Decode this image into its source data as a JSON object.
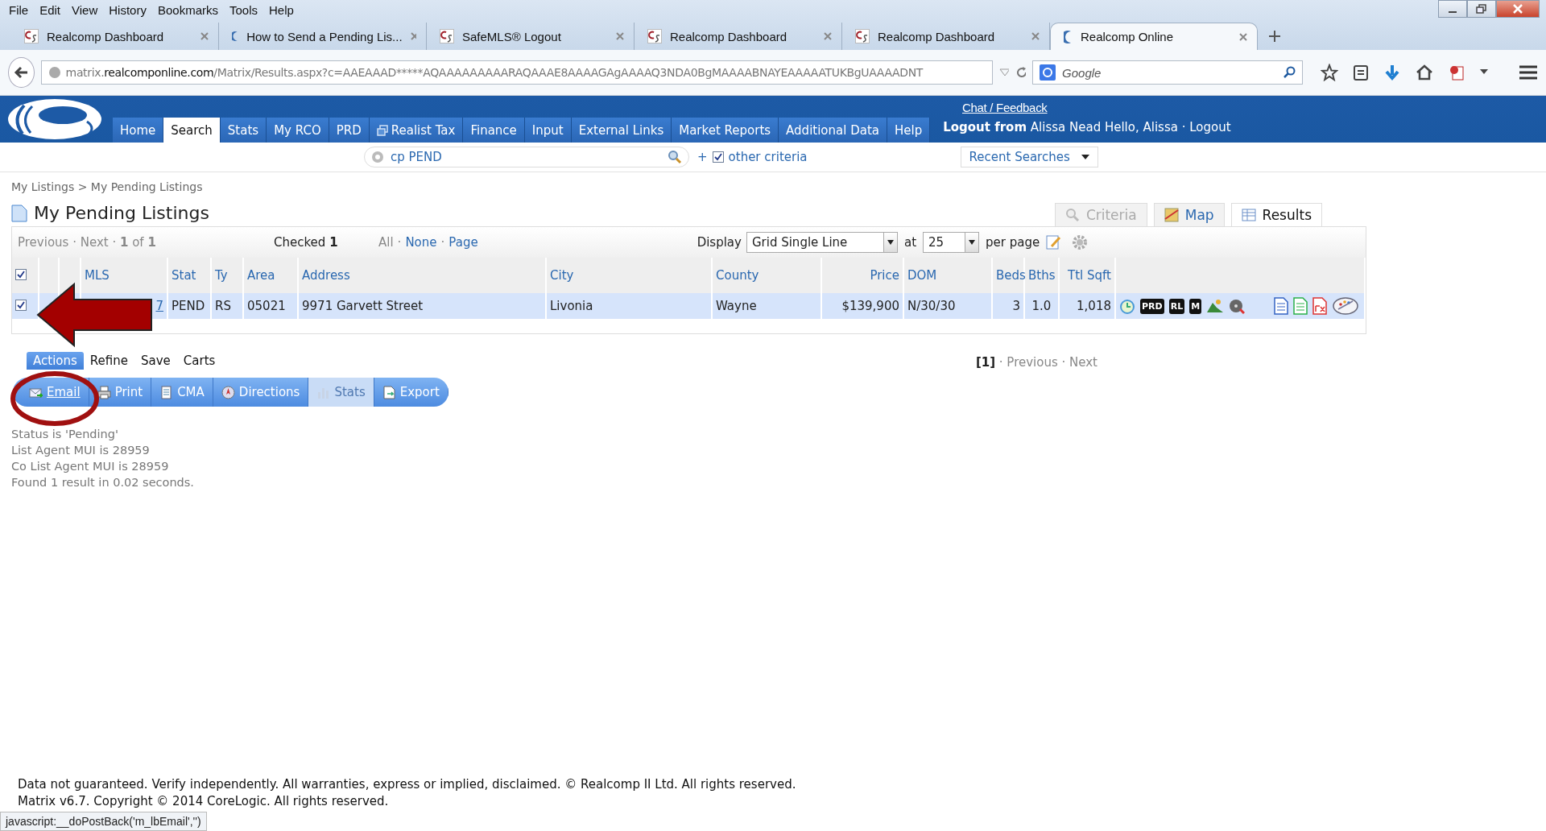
{
  "menu_bar": [
    "File",
    "Edit",
    "View",
    "History",
    "Bookmarks",
    "Tools",
    "Help"
  ],
  "browser_tabs": [
    {
      "title": "Realcomp Dashboard",
      "kind": "cs",
      "selected": false
    },
    {
      "title": "How to Send a Pending Lis...",
      "kind": "moon",
      "selected": false
    },
    {
      "title": "SafeMLS® Logout",
      "kind": "cs",
      "selected": false
    },
    {
      "title": "Realcomp Dashboard",
      "kind": "cs",
      "selected": false
    },
    {
      "title": "Realcomp Dashboard",
      "kind": "cs",
      "selected": false
    },
    {
      "title": "Realcomp Online",
      "kind": "moon",
      "selected": true
    }
  ],
  "address_bar": {
    "prefix": "matrix.",
    "host": "realcomponline.com",
    "rest": "/Matrix/Results.aspx?c=AAEAAAD*****AQAAAAAAAAARAQAAAE8AAAAGAgAAAAQ3NDA0BgMAAAABNAYEAAAAATUKBgUAAAADNT"
  },
  "search_box": {
    "placeholder": "Google"
  },
  "site_header": {
    "chat_link": "Chat / Feedback",
    "user_line": "**Logout from** Alissa Nead Hello, Alissa · Logout",
    "nav": [
      {
        "label": "Home",
        "selected": false
      },
      {
        "label": "Search",
        "selected": true
      },
      {
        "label": "Stats",
        "selected": false
      },
      {
        "label": "My RCO",
        "selected": false
      },
      {
        "label": "PRD",
        "selected": false
      },
      {
        "label": "Realist Tax",
        "selected": false,
        "kind": "external"
      },
      {
        "label": "Finance",
        "selected": false
      },
      {
        "label": "Input",
        "selected": false
      },
      {
        "label": "External Links",
        "selected": false
      },
      {
        "label": "Market Reports",
        "selected": false
      },
      {
        "label": "Additional Data",
        "selected": false
      },
      {
        "label": "Help",
        "selected": false
      }
    ]
  },
  "quick_search": {
    "value": "cp PEND",
    "plus": "+",
    "other_criteria": {
      "label": "other criteria",
      "checked": true
    },
    "recent_searches": "Recent Searches"
  },
  "breadcrumb": "My Listings > My Pending Listings",
  "page_title": "My Pending Listings",
  "view_tabs": [
    {
      "label": "Criteria",
      "selected": false,
      "disabled": true
    },
    {
      "label": "Map",
      "selected": false,
      "disabled": false
    },
    {
      "label": "Results",
      "selected": true,
      "disabled": false
    }
  ],
  "paging": {
    "nav": "Previous · Next · **1** of **1**",
    "checked": "Checked **1**",
    "select_all": "All",
    "separator": "·",
    "select_none": "None",
    "select_page": "Page",
    "display_label": "Display",
    "display_value": "Grid Single Line",
    "at_label": "at",
    "per_page_value": "25",
    "per_page_label": "per page"
  },
  "table": {
    "header_checked": true,
    "columns": [
      "MLS",
      "Stat",
      "Ty",
      "Area",
      "Address",
      "City",
      "County",
      "Price",
      "DOM",
      "Beds",
      "Bths",
      "Ttl Sqft"
    ],
    "rows": [
      {
        "checked": true,
        "cells": [
          "7",
          "PEND",
          "RS",
          "05021",
          "9971 Garvett Street",
          "Livonia",
          "Wayne",
          "$139,900",
          "N/30/30",
          "3",
          "1.0",
          "1,018"
        ],
        "badges": [
          "PRD",
          "RL",
          "M"
        ]
      }
    ]
  },
  "action_tabs": [
    {
      "label": "Actions",
      "selected": true
    },
    {
      "label": "Refine",
      "selected": false
    },
    {
      "label": "Save",
      "selected": false
    },
    {
      "label": "Carts",
      "selected": false
    }
  ],
  "action_buttons": [
    {
      "label": "Email",
      "kind": "email",
      "disabled": false
    },
    {
      "label": "Print",
      "kind": "print",
      "disabled": false
    },
    {
      "label": "CMA",
      "kind": "cma",
      "disabled": false
    },
    {
      "label": "Directions",
      "kind": "directions",
      "disabled": false
    },
    {
      "label": "Stats",
      "kind": "stats",
      "disabled": true
    },
    {
      "label": "Export",
      "kind": "export",
      "disabled": false
    }
  ],
  "bottom_pager": {
    "current": "[1]",
    "links": "· Previous · Next"
  },
  "criteria_summary": [
    "Status is 'Pending'",
    "List Agent MUI is 28959",
    "Co List Agent MUI is 28959",
    "Found 1 result in 0.02 seconds."
  ],
  "footer": [
    "Data not guaranteed. Verify independently. All warranties, express or implied, disclaimed. © Realcomp II Ltd. All rights reserved.",
    "Matrix v6.7. Copyright © 2014 CoreLogic. All rights reserved."
  ],
  "status_url": "javascript:__doPostBack('m_lbEmail','')"
}
